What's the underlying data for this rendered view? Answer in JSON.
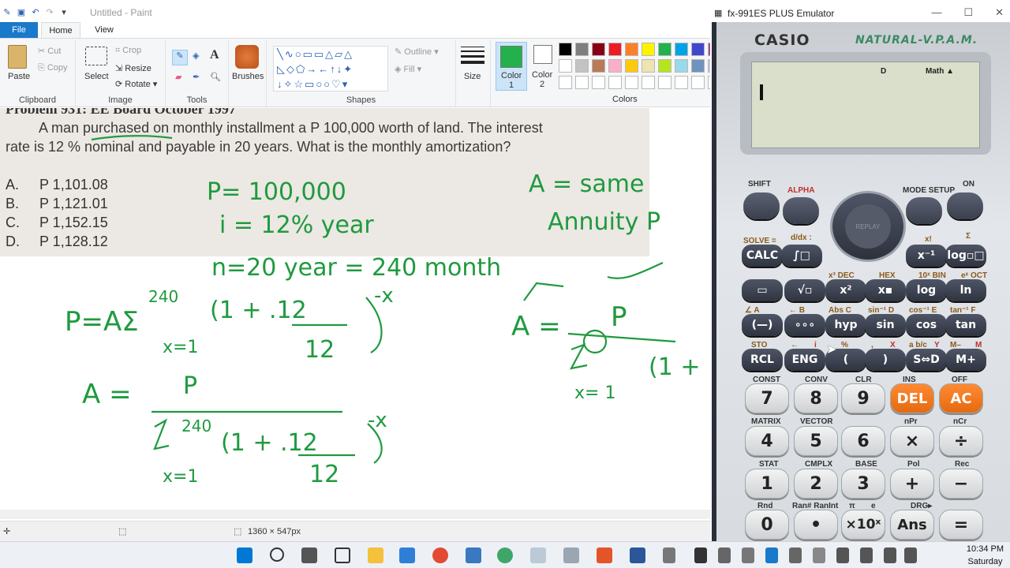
{
  "paint": {
    "title": "Untitled - Paint",
    "tabs": {
      "file": "File",
      "home": "Home",
      "view": "View"
    },
    "clipboard": {
      "paste": "Paste",
      "cut": "Cut",
      "copy": "Copy",
      "label": "Clipboard"
    },
    "image": {
      "select": "Select",
      "crop": "Crop",
      "resize": "Resize",
      "rotate": "Rotate",
      "label": "Image"
    },
    "tools": {
      "label": "Tools"
    },
    "brushes": {
      "label": "Brushes"
    },
    "shapes": {
      "label": "Shapes",
      "outline": "Outline",
      "fill": "Fill"
    },
    "size": {
      "label": "Size"
    },
    "colors": {
      "color1": "Color",
      "color1_num": "1",
      "color2": "Color",
      "color2_num": "2",
      "label": "Colors",
      "palette": [
        "#000000",
        "#7f7f7f",
        "#880015",
        "#ed1c24",
        "#ff7f27",
        "#fff200",
        "#22b14c",
        "#00a2e8",
        "#3f48cc",
        "#a349a4",
        "#ffffff",
        "#c3c3c3",
        "#b97a57",
        "#ffaec9",
        "#ffc90e",
        "#efe4b0",
        "#b5e61d",
        "#99d9ea",
        "#7092be",
        "#c8bfe7",
        "#ffffff",
        "#ffffff",
        "#ffffff",
        "#ffffff",
        "#ffffff",
        "#ffffff",
        "#ffffff",
        "#ffffff",
        "#ffffff",
        "#ffffff"
      ]
    },
    "canvas": {
      "problem_head": "Problem 931: EE Board October 1997",
      "line1": "A man purchased on monthly installment a P 100,000 worth of land. The interest",
      "line2": "rate is 12 % nominal and payable in 20 years. What is the monthly amortization?",
      "choices": [
        {
          "letter": "A.",
          "value": "P 1,101.08"
        },
        {
          "letter": "B.",
          "value": "P 1,121.01"
        },
        {
          "letter": "C.",
          "value": "P 1,152.15"
        },
        {
          "letter": "D.",
          "value": "P 1,128.12"
        }
      ],
      "hw": {
        "p": "P= 100,000",
        "i": "i = 12%  year",
        "n": "n=20 year = 240 month",
        "a_same": "A = same",
        "annuity": "Annuity P",
        "sum_top": "240",
        "sum_eq": "P=AΣ",
        "x1": "x=1",
        "one_plus": "(1 + .12",
        "den12": "12",
        "negx": "-x",
        "a_eq": "A =",
        "p_num": "P",
        "x1b": "x=1",
        "one_plus2": "(1 +",
        "sum_top2": "240",
        "one_plus3": "(1 + .12",
        "den12b": "12",
        "negx2": "-x",
        "x1c": "x= 1",
        "a_eq2": "A =",
        "p2": "P"
      }
    },
    "status": {
      "dims": "1360 × 547px"
    }
  },
  "calc": {
    "title": "fx-991ES PLUS Emulator",
    "brand": "CASIO",
    "natural": "NATURAL-V.P.A.M.",
    "lcd": {
      "d": "D",
      "math": "Math ▲"
    },
    "top": {
      "shift": "SHIFT",
      "alpha": "ALPHA",
      "mode": "MODE SETUP",
      "on": "ON",
      "replay": "REPLAY"
    },
    "r1": {
      "solve": "SOLVE =",
      "dx": "d/dx :",
      "xfact": "x!",
      "sum": "Σ",
      "calc": "CALC",
      "int": "∫□",
      "xinv": "x⁻¹",
      "log": "log▫□"
    },
    "r2": {
      "dec": "x³ DEC",
      "hex": "HEX",
      "bin": "10ˣ BIN",
      "oct": "eˣ OCT",
      "frac": "▭",
      "sqrt": "√▫",
      "x2": "x²",
      "xn": "x▪",
      "log": "log",
      "ln": "ln"
    },
    "r3": {
      "ang": "∠ A",
      "b": "← B",
      "abs": "Abs C",
      "sinv": "sin⁻¹ D",
      "cosv": "cos⁻¹ E",
      "tanv": "tan⁻¹ F",
      "neg": "(—)",
      "dms": "∘∘∘",
      "hyp": "hyp",
      "sin": "sin",
      "cos": "cos",
      "tan": "tan"
    },
    "r4": {
      "sto": "STO",
      "arrow": "←",
      "i": "i",
      "pct": "%",
      "comma": ",",
      "x": "X",
      "abc": "a b/c",
      "y": "Y",
      "mminus": "M–",
      "m": "M",
      "rcl": "RCL",
      "eng": "ENG",
      "lp": "(",
      "rp": ")",
      "sd": "S⇔D",
      "mplus": "M+"
    },
    "n1": {
      "const": "CONST",
      "conv": "CONV",
      "clr": "CLR",
      "ins": "INS",
      "off": "OFF",
      "k7": "7",
      "k8": "8",
      "k9": "9",
      "del": "DEL",
      "ac": "AC"
    },
    "n2": {
      "matrix": "MATRIX",
      "vector": "VECTOR",
      "npr": "nPr",
      "ncr": "nCr",
      "k4": "4",
      "k5": "5",
      "k6": "6",
      "mul": "×",
      "div": "÷"
    },
    "n3": {
      "stat": "STAT",
      "cmplx": "CMPLX",
      "base": "BASE",
      "pol": "Pol",
      "rec": "Rec",
      "k1": "1",
      "k2": "2",
      "k3": "3",
      "plus": "+",
      "minus": "−"
    },
    "n4": {
      "rnd": "Rnd",
      "ran": "Ran# RanInt",
      "pi": "π",
      "e": "e",
      "drg": "DRG▸",
      "k0": "0",
      "dot": "•",
      "exp": "×10ˣ",
      "ans": "Ans",
      "eq": "="
    }
  },
  "taskbar": {
    "time": "10:34 PM",
    "day": "Saturday"
  }
}
